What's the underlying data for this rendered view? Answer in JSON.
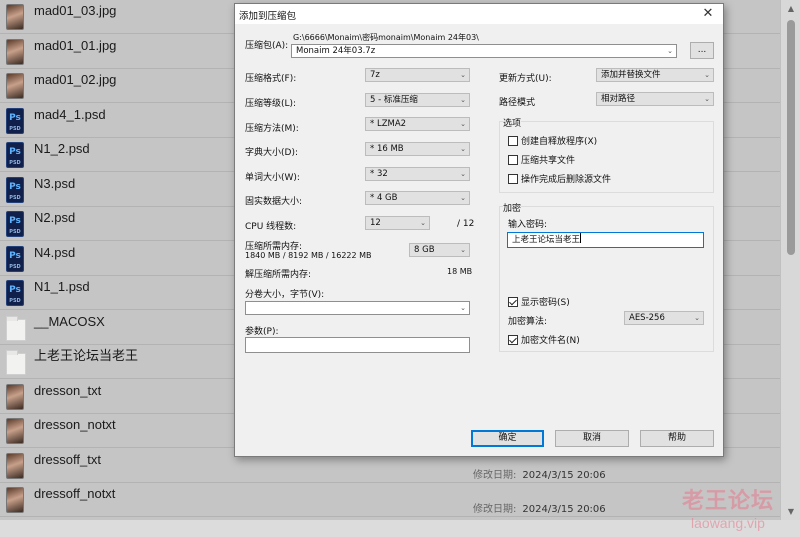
{
  "files": [
    {
      "name": "mad01_03.jpg",
      "icon": "image-thumbnail-icon",
      "type": "img"
    },
    {
      "name": "mad01_01.jpg",
      "icon": "image-thumbnail-icon",
      "type": "img"
    },
    {
      "name": "mad01_02.jpg",
      "icon": "image-thumbnail-icon",
      "type": "img"
    },
    {
      "name": "mad4_1.psd",
      "icon": "psd-file-icon",
      "type": "psd"
    },
    {
      "name": "N1_2.psd",
      "icon": "psd-file-icon",
      "type": "psd"
    },
    {
      "name": "N3.psd",
      "icon": "psd-file-icon",
      "type": "psd"
    },
    {
      "name": "N2.psd",
      "icon": "psd-file-icon",
      "type": "psd"
    },
    {
      "name": "N4.psd",
      "icon": "psd-file-icon",
      "type": "psd"
    },
    {
      "name": "N1_1.psd",
      "icon": "psd-file-icon",
      "type": "psd"
    },
    {
      "name": "__MACOSX",
      "icon": "folder-icon",
      "type": "folder"
    },
    {
      "name": "上老王论坛当老王",
      "icon": "folder-icon",
      "type": "folder"
    },
    {
      "name": "dresson_txt",
      "icon": "image-thumbnail-icon",
      "type": "img"
    },
    {
      "name": "dresson_notxt",
      "icon": "image-thumbnail-icon",
      "type": "img"
    },
    {
      "name": "dressoff_txt",
      "icon": "image-thumbnail-icon",
      "type": "img",
      "meta_label": "修改日期:",
      "meta_date": "2024/3/15 20:06"
    },
    {
      "name": "dressoff_notxt",
      "icon": "image-thumbnail-icon",
      "type": "img",
      "meta_label": "修改日期:",
      "meta_date": "2024/3/15 20:06"
    }
  ],
  "psd_icon_text": "Ps",
  "psd_icon_sub": "PSD",
  "watermark": {
    "cn": "老王论坛",
    "en": "laowang.vip"
  },
  "dialog": {
    "title": "添加到压缩包",
    "close_icon": "close-icon",
    "archive_label": "压缩包(A):",
    "archive_path": "G:\\6666\\Monaim\\密码monaim\\Monaim 24年03\\",
    "archive_name": "Monaim 24年03.7z",
    "browse_label": "...",
    "format_label": "压缩格式(F):",
    "format_value": "7z",
    "level_label": "压缩等级(L):",
    "level_value": "5 - 标准压缩",
    "method_label": "压缩方法(M):",
    "method_value": "* LZMA2",
    "dict_label": "字典大小(D):",
    "dict_value": "* 16 MB",
    "word_label": "单词大小(W):",
    "word_value": "* 32",
    "solid_label": "固实数据大小:",
    "solid_value": "* 4 GB",
    "cpu_label": "CPU 线程数:",
    "cpu_value": "12",
    "cpu_total": "/ 12",
    "mem_label": "压缩所需内存:",
    "mem_detail": "1840 MB / 8192 MB / 16222 MB",
    "mem_value": "8 GB",
    "decomp_label": "解压缩所需内存:",
    "decomp_value": "18 MB",
    "split_label": "分卷大小，字节(V):",
    "split_value": "",
    "params_label": "参数(P):",
    "params_value": "",
    "update_label": "更新方式(U):",
    "update_value": "添加并替换文件",
    "path_mode_label": "路径模式",
    "path_mode_value": "相对路径",
    "options_title": "选项",
    "opt_sfx": "创建自释放程序(X)",
    "opt_shared": "压缩共享文件",
    "opt_delete": "操作完成后删除源文件",
    "encrypt_title": "加密",
    "password_label": "输入密码:",
    "password_value": "上老王论坛当老王",
    "show_password": "显示密码(S)",
    "enc_method_label": "加密算法:",
    "enc_method_value": "AES-256",
    "encrypt_names": "加密文件名(N)",
    "ok_label": "确定",
    "cancel_label": "取消",
    "help_label": "帮助"
  }
}
